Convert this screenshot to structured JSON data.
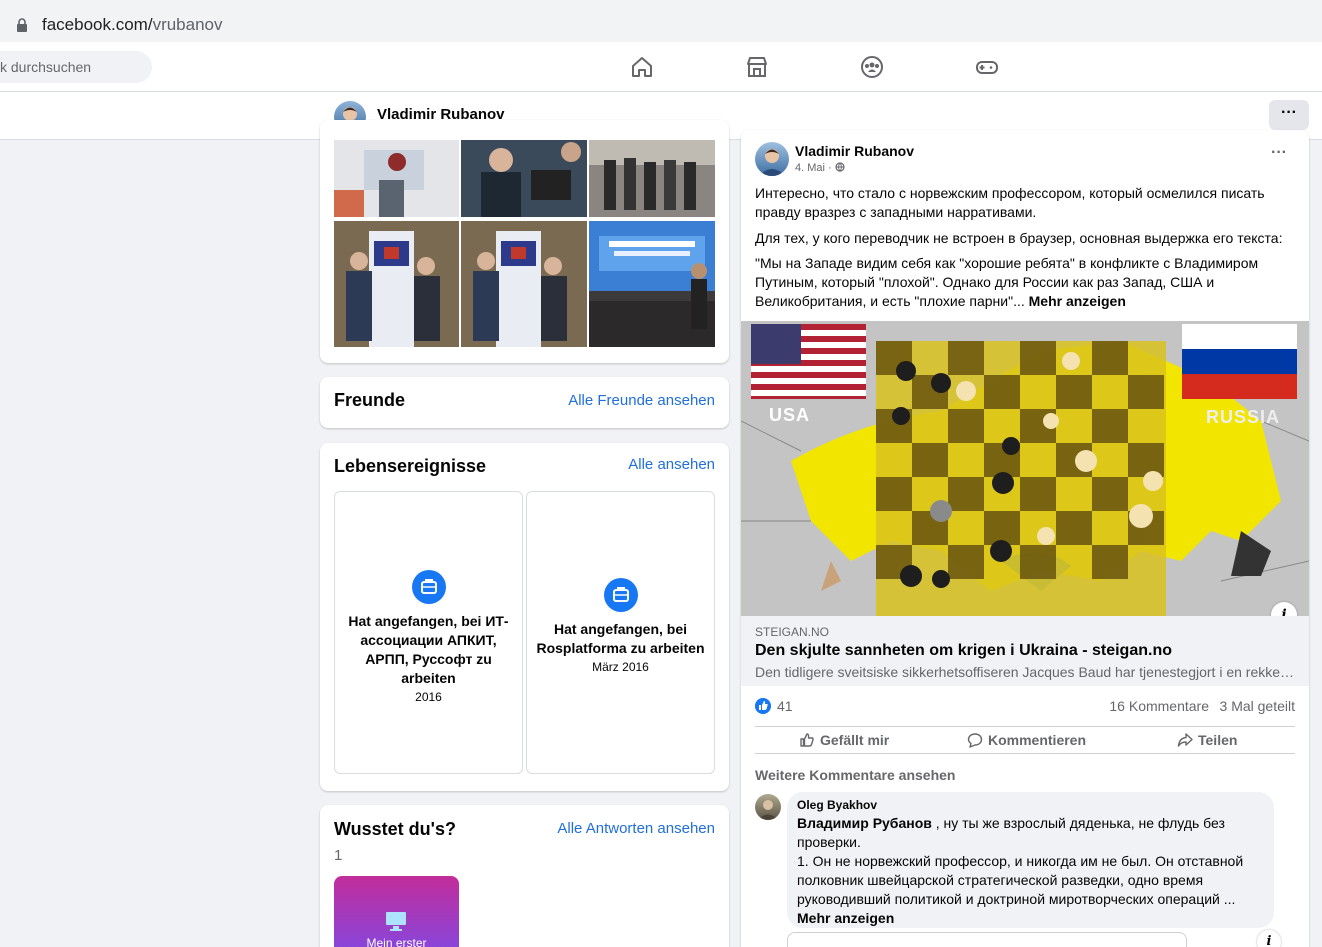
{
  "browser": {
    "url_host": "facebook.com/",
    "url_path": "vrubanov"
  },
  "nav": {
    "search_placeholder": "k durchsuchen",
    "icons": [
      "home-icon",
      "marketplace-icon",
      "groups-icon",
      "gaming-icon"
    ]
  },
  "profile": {
    "name": "Vladimir Rubanov",
    "more": "···"
  },
  "friends": {
    "title": "Freunde",
    "link": "Alle Freunde ansehen"
  },
  "life_events": {
    "title": "Lebensereignisse",
    "link": "Alle ansehen",
    "items": [
      {
        "text": "Hat angefangen, bei ИТ-ассоциации АПКИТ, АРПП, Руссофт zu arbeiten",
        "date": "2016"
      },
      {
        "text": "Hat angefangen, bei Rosplatforma zu arbeiten",
        "date": "März 2016"
      }
    ]
  },
  "did_you_know": {
    "title": "Wusstet du's?",
    "link": "Alle Antworten ansehen",
    "count": "1",
    "tile_label": "Mein erster"
  },
  "post": {
    "author": "Vladimir Rubanov",
    "date": "4. Mai · ",
    "menu": "···",
    "p1": "Интересно, что стало с норвежским профессором, который осмелился писать правду вразрез с западными нарративами.",
    "p2": "Для тех, у кого переводчик не встроен в браузер, основная выдержка его текста:",
    "p3": "\"Мы на Западе видим себя как \"хорошие ребята\" в конфликте с Владимиром Путиным, который \"плохой\". Однако для России как раз Запад, США и Великобритания, и есть \"плохие парни\"...",
    "p3_more": " Mehr anzeigen",
    "image_labels": {
      "left": "USA",
      "right": "RUSSIA"
    },
    "info": "i",
    "link": {
      "domain": "STEIGAN.NO",
      "title": "Den skjulte sannheten om krigen i Ukraina - steigan.no",
      "desc": "Den tidligere sveitsiske sikkerhetsoffiseren Jacques Baud har tjenestegjort i en rekke stillinger"
    },
    "likes": "41",
    "comments": "16 Kommentare",
    "shares": "3 Mal geteilt",
    "actions": {
      "like": "Gefällt mir",
      "comment": "Kommentieren",
      "share": "Teilen"
    },
    "more_comments": "Weitere Kommentare ansehen",
    "comment": {
      "author": "Oleg Byakhov",
      "mention": "Владимир Рубанов",
      "text": " , ну ты же взрослый дяденька, не флудь без проверки.",
      "text2": "1. Он не норвежский профессор, и никогда им не был. Он отставной полковник швейцарской стратегической разведки, одно время руководивший политикой и доктриной миротворческих операций ...",
      "more": "Mehr anzeigen"
    }
  }
}
